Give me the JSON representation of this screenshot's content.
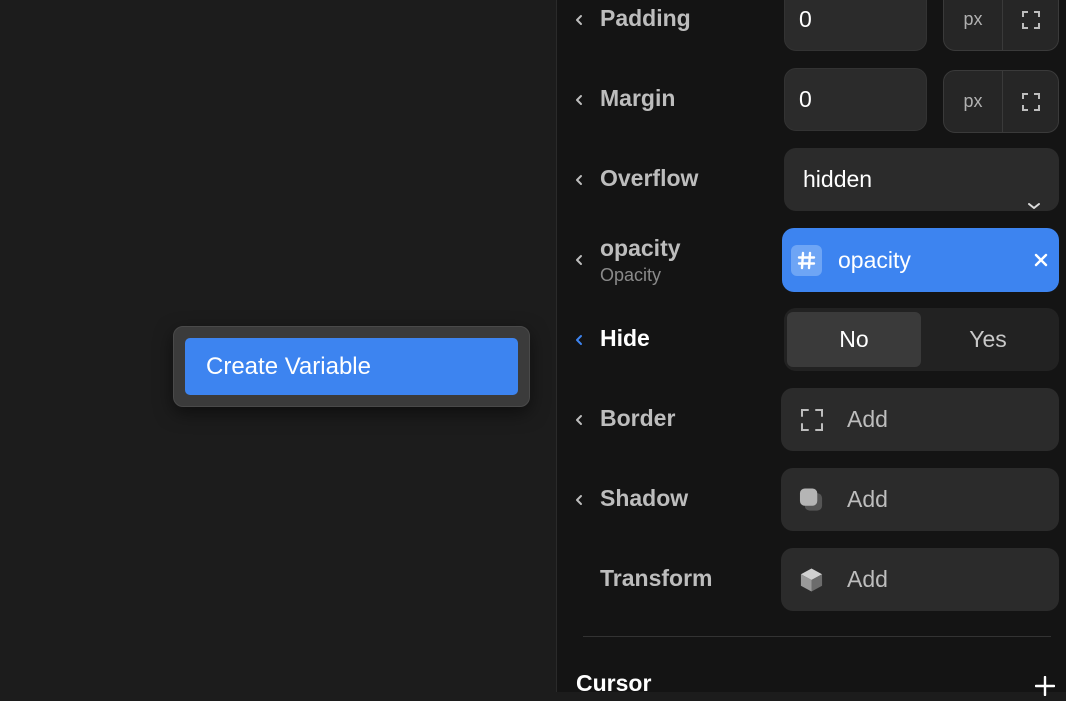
{
  "context_menu": {
    "create_variable": "Create Variable"
  },
  "panel": {
    "padding": {
      "label": "Padding",
      "value": "0",
      "unit": "px"
    },
    "margin": {
      "label": "Margin",
      "value": "0",
      "unit": "px"
    },
    "overflow": {
      "label": "Overflow",
      "value": "hidden"
    },
    "opacity": {
      "label": "opacity",
      "sublabel": "Opacity",
      "variable": "opacity"
    },
    "hide": {
      "label": "Hide",
      "options": [
        "No",
        "Yes"
      ],
      "selected": "No"
    },
    "border": {
      "label": "Border",
      "add_label": "Add"
    },
    "shadow": {
      "label": "Shadow",
      "add_label": "Add"
    },
    "transform": {
      "label": "Transform",
      "add_label": "Add"
    },
    "cursor_section": {
      "title": "Cursor"
    }
  },
  "colors": {
    "accent": "#3d84f0",
    "panel_bg": "#141414",
    "canvas_bg": "#1c1c1c"
  }
}
